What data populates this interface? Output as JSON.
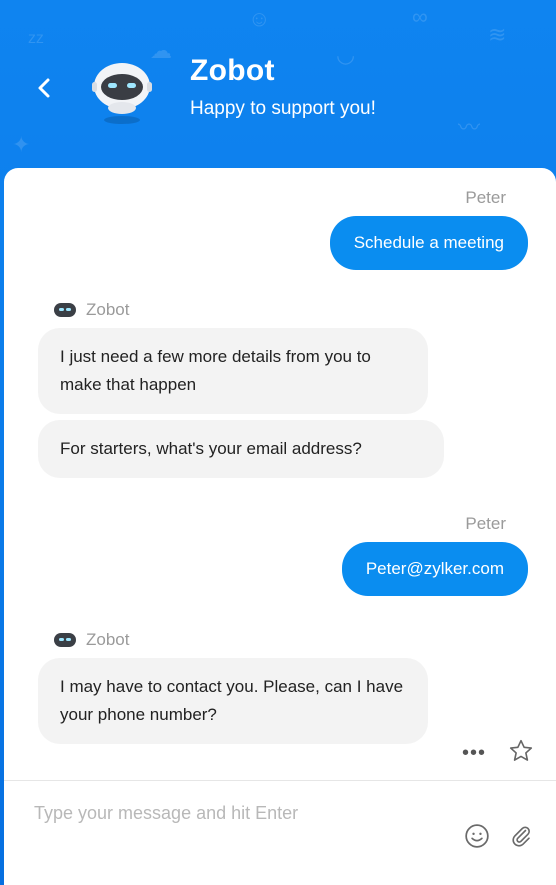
{
  "header": {
    "bot_name": "Zobot",
    "tagline": "Happy to support you!"
  },
  "messages": [
    {
      "from": "user",
      "sender": "Peter",
      "text": "Schedule a meeting"
    },
    {
      "from": "bot",
      "sender": "Zobot",
      "texts": [
        "I just need a few more details from you to make that happen",
        "For starters, what's your email address?"
      ]
    },
    {
      "from": "user",
      "sender": "Peter",
      "text": "Peter@zylker.com"
    },
    {
      "from": "bot",
      "sender": "Zobot",
      "texts": [
        "I may have to contact you. Please, can I have your phone number?"
      ]
    }
  ],
  "composer": {
    "placeholder": "Type your message and hit Enter"
  },
  "icons": {
    "back": "chevron-left-icon",
    "avatar": "robot-avatar-icon",
    "more": "more-dots-icon",
    "rate": "star-icon",
    "emoji": "smiley-icon",
    "attach": "paperclip-icon"
  },
  "colors": {
    "header_blue": "#0a7ae8",
    "user_bubble": "#0a8df0",
    "bot_bubble": "#f3f3f3"
  }
}
